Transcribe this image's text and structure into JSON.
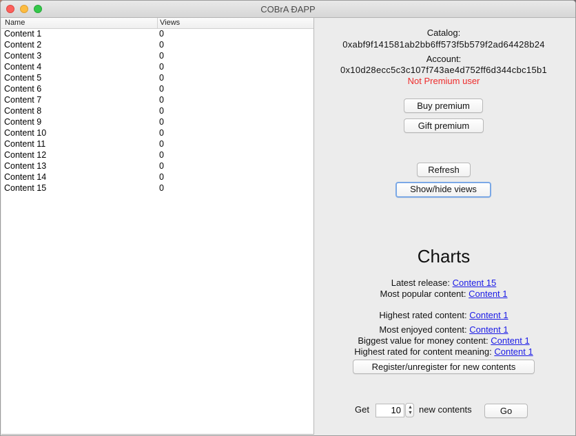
{
  "window": {
    "title": "COBrA ÐAPP"
  },
  "table": {
    "columns": [
      "Name",
      "Views"
    ],
    "rows": [
      {
        "name": "Content 1",
        "views": "0"
      },
      {
        "name": "Content 2",
        "views": "0"
      },
      {
        "name": "Content 3",
        "views": "0"
      },
      {
        "name": "Content 4",
        "views": "0"
      },
      {
        "name": "Content 5",
        "views": "0"
      },
      {
        "name": "Content 6",
        "views": "0"
      },
      {
        "name": "Content 7",
        "views": "0"
      },
      {
        "name": "Content 8",
        "views": "0"
      },
      {
        "name": "Content 9",
        "views": "0"
      },
      {
        "name": "Content 10",
        "views": "0"
      },
      {
        "name": "Content 11",
        "views": "0"
      },
      {
        "name": "Content 12",
        "views": "0"
      },
      {
        "name": "Content 13",
        "views": "0"
      },
      {
        "name": "Content 14",
        "views": "0"
      },
      {
        "name": "Content 15",
        "views": "0"
      }
    ]
  },
  "info": {
    "catalog_label": "Catalog:",
    "catalog_address": "0xabf9f141581ab2bb6ff573f5b579f2ad64428b24",
    "account_label": "Account:",
    "account_address": "0x10d28ecc5c3c107f743ae4d752ff6d344cbc15b1",
    "premium_status": "Not Premium user",
    "premium_status_color": "#ee2b2b"
  },
  "buttons": {
    "buy_premium": "Buy premium",
    "gift_premium": "Gift premium",
    "refresh": "Refresh",
    "show_hide_views": "Show/hide views",
    "register": "Register/unregister for new contents",
    "go": "Go"
  },
  "charts": {
    "title": "Charts",
    "latest_release_label": "Latest release:",
    "latest_release_value": "Content 15",
    "most_popular_label": "Most popular content:",
    "most_popular_value": "Content 1",
    "highest_rated_label": "Highest rated content:",
    "highest_rated_value": "Content 1",
    "most_enjoyed_label": "Most enjoyed content:",
    "most_enjoyed_value": "Content 1",
    "biggest_value_label": "Biggest value for money content:",
    "biggest_value_value": "Content 1",
    "highest_meaning_label": "Highest rated for content meaning:",
    "highest_meaning_value": "Content 1"
  },
  "new_contents": {
    "get_label": "Get",
    "count": "10",
    "suffix_label": "new contents"
  },
  "colors": {
    "link": "#1a1ae6",
    "focus_ring": "#7aa8e6"
  }
}
